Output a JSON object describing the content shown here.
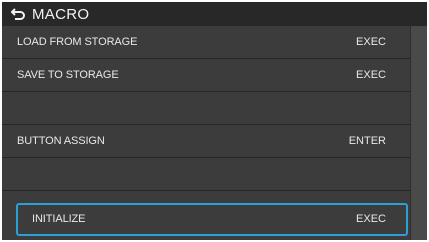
{
  "header": {
    "title": "MACRO",
    "back_icon": "back-return-arrow-icon"
  },
  "menu": {
    "items": [
      {
        "label": "LOAD FROM STORAGE",
        "action": "EXEC"
      },
      {
        "label": "SAVE TO STORAGE",
        "action": "EXEC"
      },
      {
        "label": "",
        "action": ""
      },
      {
        "label": "BUTTON ASSIGN",
        "action": "ENTER"
      },
      {
        "label": "",
        "action": ""
      },
      {
        "label": "INITIALIZE",
        "action": "EXEC"
      }
    ],
    "selected_index": 5
  },
  "colors": {
    "background": "#3c3c3c",
    "titlebar": "#282828",
    "text": "#e8e8e8",
    "selection_border": "#2a9fd8"
  }
}
